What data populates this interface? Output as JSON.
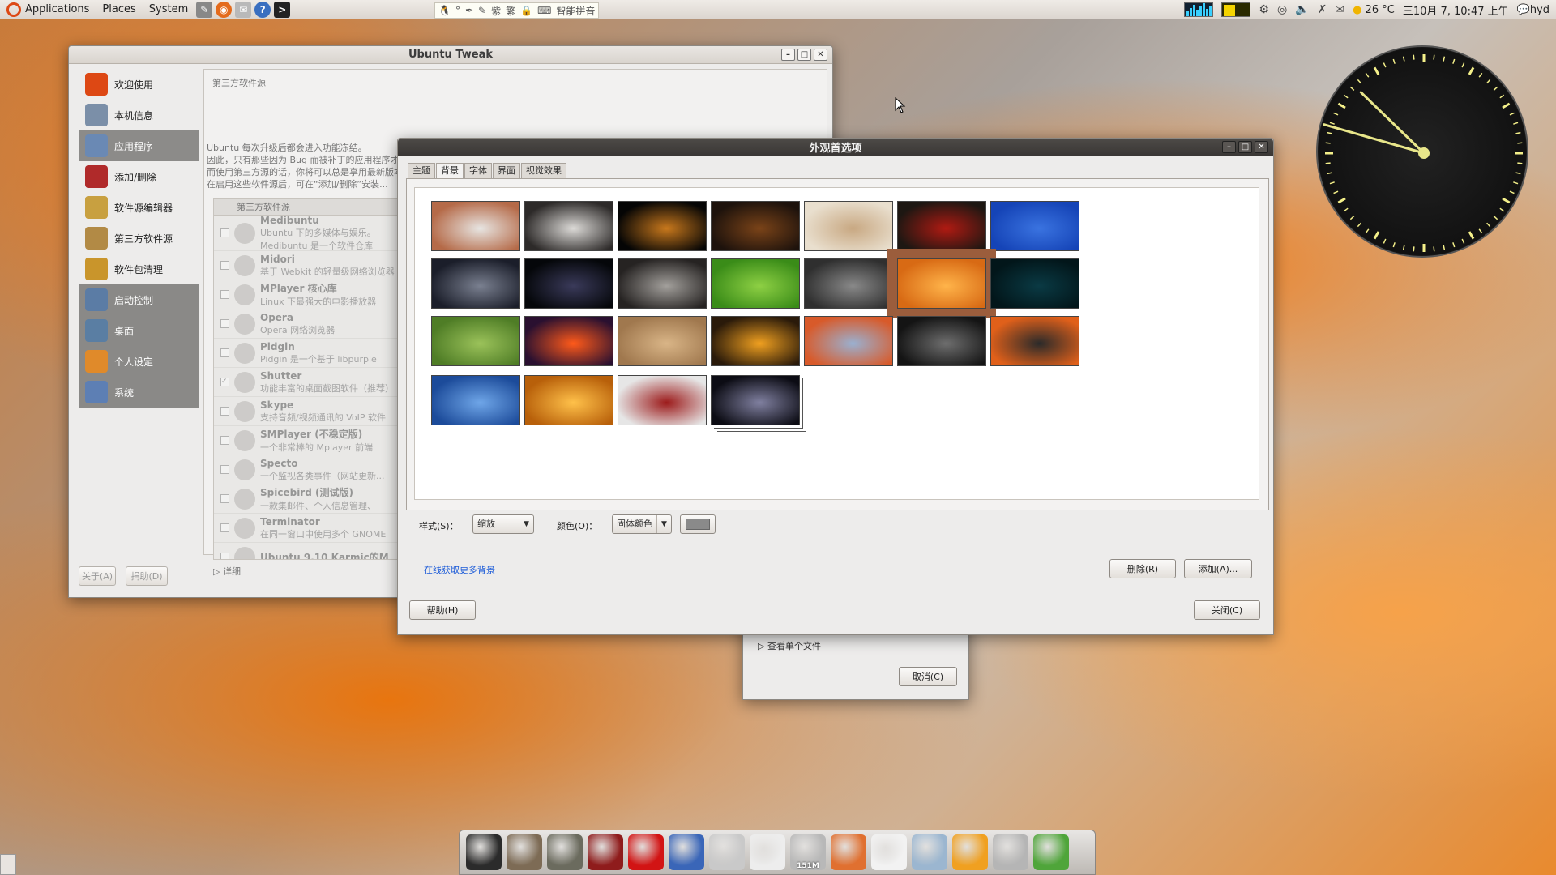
{
  "top_panel": {
    "menus": [
      "Applications",
      "Places",
      "System"
    ],
    "ime_text": "智能拼音",
    "ime_glyphs": [
      "紫",
      "繁"
    ],
    "weather": "26 °C",
    "datetime": "三10月 7, 10:47 上午",
    "user": "hyd"
  },
  "tweak": {
    "title": "Ubuntu Tweak",
    "sidebar": [
      {
        "label": "欢迎使用",
        "icon": "ubuntu-icon",
        "color": "#dd4814"
      },
      {
        "label": "本机信息",
        "icon": "computer-icon",
        "color": "#7b8fa8"
      },
      {
        "label": "应用程序",
        "icon": "apps-icon",
        "color": "#6a89b4"
      },
      {
        "label": "添加/删除",
        "icon": "add-remove-icon",
        "color": "#b02a2a"
      },
      {
        "label": "软件源编辑器",
        "icon": "source-editor-icon",
        "color": "#c8a040"
      },
      {
        "label": "第三方软件源",
        "icon": "third-party-icon",
        "color": "#b28a45"
      },
      {
        "label": "软件包清理",
        "icon": "package-clean-icon",
        "color": "#c9952b"
      },
      {
        "label": "启动控制",
        "icon": "startup-icon",
        "color": "#5b7ca5"
      },
      {
        "label": "桌面",
        "icon": "desktop-icon",
        "color": "#5a7ea3"
      },
      {
        "label": "个人设定",
        "icon": "personal-icon",
        "color": "#e08a2a"
      },
      {
        "label": "系统",
        "icon": "system-icon",
        "color": "#5d7fb4"
      }
    ],
    "section_title": "第三方软件源",
    "intro": [
      "Ubuntu 每次升级后都会进入功能冻结。",
      "因此，只有那些因为 Bug 而被补丁的应用程序才会得到软件源更新。",
      "而使用第三方源的话，你将可以总是享用最新版本的应用程序。",
      "在启用这些软件源后，可在“添加/删除”安装..."
    ],
    "list_header": "第三方软件源",
    "sources": [
      {
        "name": "Medibuntu",
        "desc": "Ubuntu 下的多媒体与娱乐。",
        "desc2": "Medibuntu 是一个软件仓库",
        "checked": false
      },
      {
        "name": "Midori",
        "desc": "基于 Webkit 的轻量级网络浏览器",
        "checked": false
      },
      {
        "name": "MPlayer 核心库",
        "desc": "Linux 下最强大的电影播放器",
        "checked": false
      },
      {
        "name": "Opera",
        "desc": "Opera 网络浏览器",
        "checked": false
      },
      {
        "name": "Pidgin",
        "desc": "Pidgin 是一个基于 libpurple",
        "checked": false
      },
      {
        "name": "Shutter",
        "desc": "功能丰富的桌面截图软件（推荐）",
        "checked": true
      },
      {
        "name": "Skype",
        "desc": "支持音频/视频通讯的 VoIP 软件",
        "checked": false
      },
      {
        "name": "SMPlayer (不稳定版)",
        "desc": "一个非常棒的 Mplayer 前端",
        "checked": false
      },
      {
        "name": "Specto",
        "desc": "一个监视各类事件（网站更新...",
        "checked": false
      },
      {
        "name": "Spicebird (测试版)",
        "desc": "一款集邮件、个人信息管理、",
        "checked": false
      },
      {
        "name": "Terminator",
        "desc": "在同一窗口中使用多个 GNOME",
        "checked": false
      },
      {
        "name": "Ubuntu 9.10 Karmic的M",
        "desc": "",
        "checked": false
      }
    ],
    "details_label": "详细",
    "about_btn": "关于(A)",
    "donate_btn": "捐助(D)"
  },
  "appearance": {
    "title": "外观首选项",
    "tabs": [
      "主题",
      "背景",
      "字体",
      "界面",
      "视觉效果"
    ],
    "active_tab": 1,
    "thumbs": [
      [
        "#b56a48",
        "#e7e5e2"
      ],
      [
        "#2d2a29",
        "#dcdad7"
      ],
      [
        "#050505",
        "#c8781c"
      ],
      [
        "#1d120c",
        "#7a4318"
      ],
      [
        "#e9dfce",
        "#c8a882"
      ],
      [
        "#1d1712",
        "#b01a12"
      ],
      [
        "#1544b7",
        "#3a73e0"
      ],
      [
        "#1b1e2a",
        "#7a8090"
      ],
      [
        "#05070a",
        "#3a3a5a"
      ],
      [
        "#262322",
        "#a3a09c"
      ],
      [
        "#3a8c18",
        "#8ed044"
      ],
      [
        "#2f2f2f",
        "#898989"
      ],
      [
        "#d86a14",
        "#ffb44a"
      ],
      [
        "#02161a",
        "#0a3a44"
      ],
      [
        "#4f7d26",
        "#9bc25a"
      ],
      [
        "#2a1030",
        "#ff5a1a"
      ],
      [
        "#a0784e",
        "#d9b587"
      ],
      [
        "#2a1a0a",
        "#f0a020"
      ],
      [
        "#d85a2a",
        "#9ab0d0"
      ],
      [
        "#141414",
        "#6e6e6e"
      ],
      [
        "#e0601a",
        "#2a2a2a"
      ],
      [
        "#1c4b9a",
        "#6fa6e8"
      ],
      [
        "#b8600a",
        "#ffc14a"
      ],
      [
        "#e6e6e6",
        "#9c1a1a"
      ],
      [
        "#0c0c14",
        "#8080a0"
      ]
    ],
    "selected_thumb": 12,
    "style_label": "样式(S)：",
    "style_value": "缩放",
    "color_label": "颜色(O)：",
    "color_value": "固体颜色",
    "swatch": "#8a8a8a",
    "get_more_link": "在线获取更多背景",
    "delete_btn": "删除(R)",
    "add_btn": "添加(A)...",
    "help_btn": "帮助(H)",
    "close_btn": "关闭(C)"
  },
  "bg_dialog": {
    "expander": "查看单个文件",
    "cancel_btn": "取消(C)"
  },
  "dock": [
    {
      "name": "terminal-icon",
      "color": "#2b2b2b",
      "label": ""
    },
    {
      "name": "music-player-icon",
      "color": "#7d6b55",
      "label": ""
    },
    {
      "name": "gimp-icon",
      "color": "#6b6b5e",
      "label": ""
    },
    {
      "name": "gnome-do-icon",
      "color": "#8f1c1c",
      "label": ""
    },
    {
      "name": "shutdown-icon",
      "color": "#d21414",
      "label": ""
    },
    {
      "name": "firefox-icon",
      "color": "#3a66b8",
      "label": ""
    },
    {
      "name": "mail-icon",
      "color": "#c9c9c9",
      "label": ""
    },
    {
      "name": "notes-icon",
      "color": "#ededed",
      "label": ""
    },
    {
      "name": "trash-icon",
      "color": "#b8b8b8",
      "label": "151M"
    },
    {
      "name": "ubuntu-icon",
      "color": "#e07030",
      "label": ""
    },
    {
      "name": "documents-icon",
      "color": "#f2f2f2",
      "label": ""
    },
    {
      "name": "favorites-icon",
      "color": "#9bb6d0",
      "label": ""
    },
    {
      "name": "cairo-dock-icon",
      "color": "#f0a020",
      "label": ""
    },
    {
      "name": "system-settings-icon",
      "color": "#b5b5b5",
      "label": ""
    },
    {
      "name": "update-icon",
      "color": "#4fa53a",
      "label": ""
    }
  ]
}
